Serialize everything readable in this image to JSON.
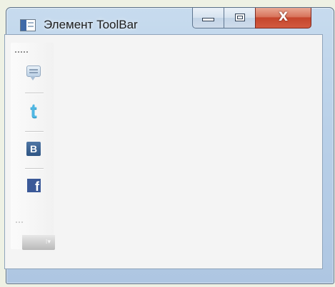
{
  "window": {
    "title": "Элемент ToolBar",
    "app_icon": "window-app-icon"
  },
  "controls": {
    "minimize_icon": "minimize-icon",
    "maximize_icon": "maximize-icon",
    "close_icon": "close-icon",
    "close_glyph": "X"
  },
  "toolbar": {
    "buttons": [
      {
        "icon": "speech-bubble-icon"
      },
      {
        "icon": "twitter-icon",
        "glyph": "t"
      },
      {
        "icon": "vk-icon",
        "glyph": "B"
      },
      {
        "icon": "facebook-icon",
        "glyph": "f"
      }
    ],
    "overflow_icon": "overflow-chevron-icon",
    "overflow_glyph": "⁞▾"
  },
  "colors": {
    "titlebar": "#b9d0e8",
    "close_button": "#c5452c",
    "client_background": "#f4f4f4",
    "twitter": "#4fb7e3",
    "vk": "#2f5584",
    "facebook": "#3b5998"
  }
}
